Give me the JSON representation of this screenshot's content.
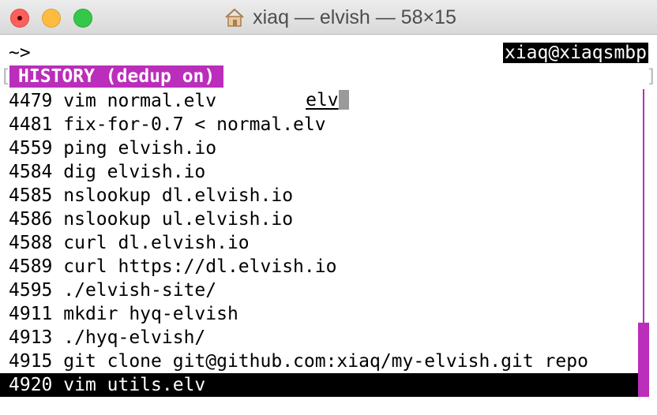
{
  "window": {
    "title": "xiaq — elvish — 58×15",
    "title_icon": "home-folder-icon",
    "buttons": [
      "close",
      "minimize",
      "zoom"
    ]
  },
  "terminal": {
    "prompt": "~>",
    "right_prompt": "xiaq@xiaqsmbp",
    "bracket_left": "[",
    "bracket_right": "]",
    "mode_badge": "HISTORY (dedup on)",
    "filter_text": "elv",
    "history": [
      {
        "id": "4479",
        "cmd": "vim normal.elv"
      },
      {
        "id": "4481",
        "cmd": "fix-for-0.7 < normal.elv"
      },
      {
        "id": "4559",
        "cmd": "ping elvish.io"
      },
      {
        "id": "4584",
        "cmd": "dig elvish.io"
      },
      {
        "id": "4585",
        "cmd": "nslookup dl.elvish.io"
      },
      {
        "id": "4586",
        "cmd": "nslookup ul.elvish.io"
      },
      {
        "id": "4588",
        "cmd": "curl dl.elvish.io"
      },
      {
        "id": "4589",
        "cmd": "curl https://dl.elvish.io"
      },
      {
        "id": "4595",
        "cmd": "./elvish-site/"
      },
      {
        "id": "4911",
        "cmd": "mkdir hyq-elvish"
      },
      {
        "id": "4913",
        "cmd": "./hyq-elvish/"
      },
      {
        "id": "4915",
        "cmd": "git clone git@github.com:xiaq/my-elvish.git repo"
      },
      {
        "id": "4920",
        "cmd": "vim utils.elv"
      }
    ],
    "selected_index": 12
  },
  "colors": {
    "accent": "#bb2dbb",
    "selection_bg": "#000000",
    "selection_fg": "#ffffff"
  }
}
